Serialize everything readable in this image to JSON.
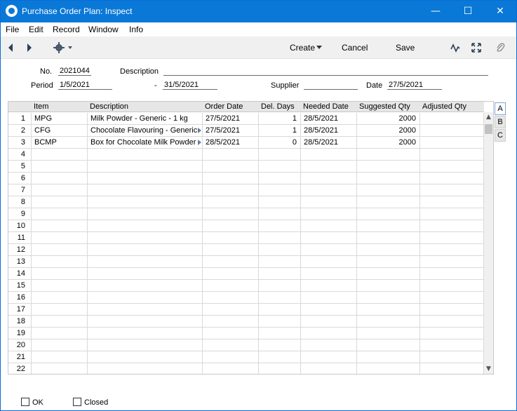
{
  "window": {
    "title": "Purchase Order Plan: Inspect"
  },
  "menu": [
    "File",
    "Edit",
    "Record",
    "Window",
    "Info"
  ],
  "toolbar": {
    "create_label": "Create",
    "cancel_label": "Cancel",
    "save_label": "Save"
  },
  "header": {
    "no_label": "No.",
    "no_value": "2021044",
    "description_label": "Description",
    "description_value": "",
    "period_label": "Period",
    "period_from": "1/5/2021",
    "period_sep": "-",
    "period_to": "31/5/2021",
    "supplier_label": "Supplier",
    "supplier_value": "",
    "date_label": "Date",
    "date_value": "27/5/2021"
  },
  "grid": {
    "columns": [
      "Item",
      "Description",
      "Order Date",
      "Del. Days",
      "Needed Date",
      "Suggested Qty",
      "Adjusted Qty"
    ],
    "rows": [
      {
        "n": "1",
        "item": "MPG",
        "description": "Milk Powder - Generic - 1 kg",
        "order_date": "27/5/2021",
        "del_days": "1",
        "needed_date": "28/5/2021",
        "suggested_qty": "2000",
        "adjusted_qty": "",
        "arrow": false
      },
      {
        "n": "2",
        "item": "CFG",
        "description": "Chocolate Flavouring - Generic",
        "order_date": "27/5/2021",
        "del_days": "1",
        "needed_date": "28/5/2021",
        "suggested_qty": "2000",
        "adjusted_qty": "",
        "arrow": true
      },
      {
        "n": "3",
        "item": "BCMP",
        "description": "Box for Chocolate Milk Powder",
        "order_date": "28/5/2021",
        "del_days": "0",
        "needed_date": "28/5/2021",
        "suggested_qty": "2000",
        "adjusted_qty": "",
        "arrow": true
      },
      {
        "n": "4"
      },
      {
        "n": "5"
      },
      {
        "n": "6"
      },
      {
        "n": "7"
      },
      {
        "n": "8"
      },
      {
        "n": "9"
      },
      {
        "n": "10"
      },
      {
        "n": "11"
      },
      {
        "n": "12"
      },
      {
        "n": "13"
      },
      {
        "n": "14"
      },
      {
        "n": "15"
      },
      {
        "n": "16"
      },
      {
        "n": "17"
      },
      {
        "n": "18"
      },
      {
        "n": "19"
      },
      {
        "n": "20"
      },
      {
        "n": "21"
      },
      {
        "n": "22"
      }
    ]
  },
  "tabs": [
    "A",
    "B",
    "C"
  ],
  "footer": {
    "ok_label": "OK",
    "closed_label": "Closed"
  }
}
